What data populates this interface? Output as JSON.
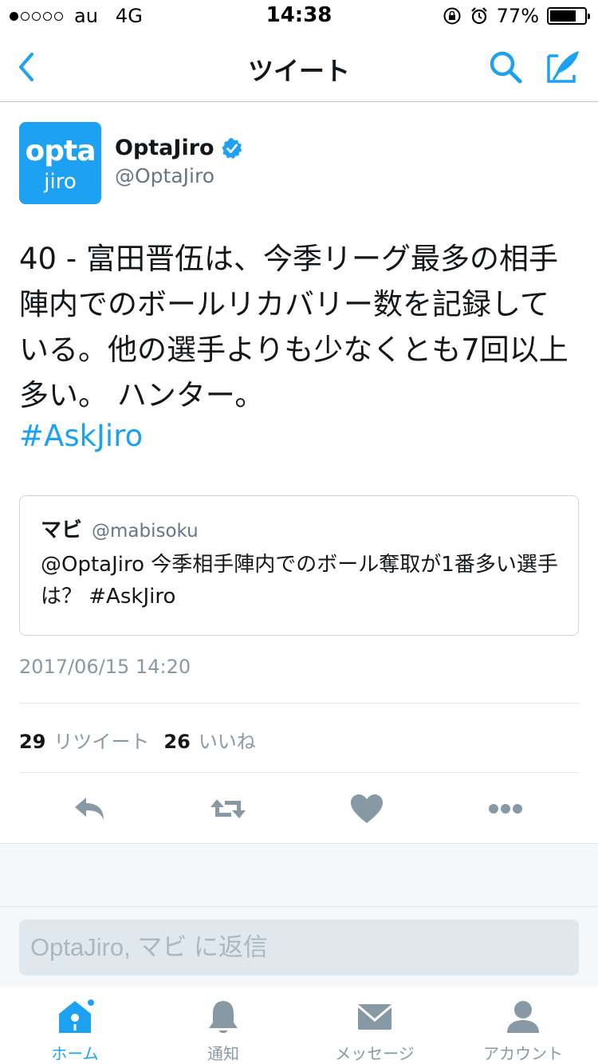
{
  "status_bar": {
    "carrier": "au",
    "network": "4G",
    "time": "14:38",
    "battery": "77%",
    "battery_level": 0.77
  },
  "nav": {
    "title": "ツイート"
  },
  "tweet": {
    "avatar_line1": "opta",
    "avatar_line2": "jiro",
    "author_name": "OptaJiro",
    "author_handle": "@OptaJiro",
    "text": "40 - 富田晋伍は、今季リーグ最多の相手陣内でのボールリカバリー数を記録している。他の選手よりも少なくとも7回以上多い。 ハンター。",
    "hashtag": "#AskJiro",
    "timestamp": "2017/06/15 14:20"
  },
  "quote": {
    "name": "マビ",
    "handle": "@mabisoku",
    "text": "@OptaJiro 今季相手陣内でのボール奪取が1番多い選手は？ #AskJiro"
  },
  "stats": {
    "retweets_count": "29",
    "retweets_label": "リツイート",
    "likes_count": "26",
    "likes_label": "いいね"
  },
  "reply": {
    "placeholder": "OptaJiro, マビ に返信"
  },
  "tabbar": {
    "home": "ホーム",
    "notifications": "通知",
    "messages": "メッセージ",
    "account": "アカウント"
  },
  "colors": {
    "accent": "#1da1f2",
    "icon_grey": "#8899a6",
    "text": "#14171a"
  }
}
